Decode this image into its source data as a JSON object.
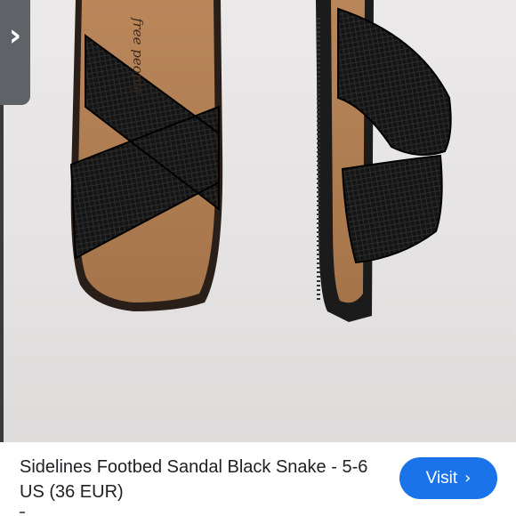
{
  "product": {
    "title": "Sidelines Footbed Sandal Black Snake - 5-6 US (36 EUR)",
    "visit_label": "Visit",
    "brand_mark": "free people"
  },
  "icons": {
    "back": "chevron-right-icon",
    "visit_arrow": "chevron-right-icon"
  },
  "colors": {
    "accent": "#1a73e8",
    "tab": "#5f6368",
    "title_text": "#202124"
  }
}
